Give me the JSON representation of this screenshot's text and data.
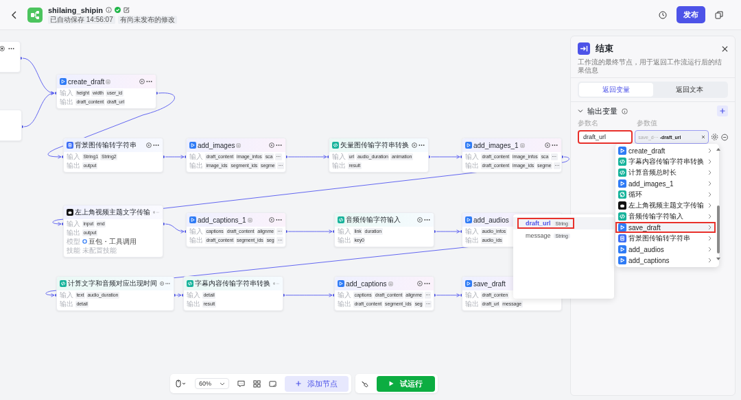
{
  "header": {
    "title": "shilaing_shipin",
    "badges": [
      "已自动保存 14:56:07",
      "有尚未发布的修改"
    ],
    "publish_button": "发布"
  },
  "canvas": {
    "nodes": [
      {
        "kind": "clipped",
        "actions": true
      },
      {
        "kind": "plugin",
        "title": "create_draft",
        "badge": true,
        "actions": true,
        "rows": [
          {
            "label": "输入",
            "kind": "params",
            "params": [
              "height",
              "width",
              "user_id"
            ]
          },
          {
            "label": "输出",
            "kind": "params",
            "params": [
              "draft_content",
              "draft_url"
            ]
          }
        ]
      },
      {
        "kind": "clipped",
        "actions": false
      },
      {
        "kind": "text",
        "title": "背景图传输转字符串",
        "badge": false,
        "actions": true,
        "rows": [
          {
            "label": "输入",
            "kind": "params",
            "params": [
              "String1",
              "String2"
            ]
          },
          {
            "label": "输出",
            "kind": "params",
            "params": [
              "output"
            ]
          }
        ]
      },
      {
        "kind": "plugin",
        "title": "add_images",
        "badge": true,
        "actions": true,
        "rows": [
          {
            "label": "输入",
            "kind": "params",
            "params": [
              "draft_content",
              "image_infos",
              "sca",
              "···"
            ]
          },
          {
            "label": "输出",
            "kind": "params",
            "params": [
              "image_ids",
              "segment_ids",
              "segme",
              "···"
            ]
          }
        ]
      },
      {
        "kind": "code",
        "title": "矢量图传输字符串转换",
        "badge": false,
        "actions": true,
        "rows": [
          {
            "label": "输入",
            "kind": "params",
            "params": [
              "url",
              "audio_duration",
              "animation"
            ]
          },
          {
            "label": "输出",
            "kind": "params",
            "params": [
              "result"
            ]
          }
        ]
      },
      {
        "kind": "plugin",
        "title": "add_images_1",
        "badge": true,
        "actions": true,
        "rows": [
          {
            "label": "输入",
            "kind": "params",
            "params": [
              "draft_content",
              "image_infos",
              "sca",
              "···"
            ]
          },
          {
            "label": "输出",
            "kind": "params",
            "params": [
              "draft_content",
              "image_ids",
              "segme",
              "···"
            ]
          }
        ]
      },
      {
        "kind": "bot",
        "title": "左上角视频主题文字传输",
        "badge": false,
        "actions": true,
        "rows": [
          {
            "label": "输入",
            "kind": "params",
            "params": [
              "input",
              "end"
            ]
          },
          {
            "label": "输出",
            "kind": "params",
            "params": [
              "output"
            ]
          },
          {
            "label": "模型",
            "kind": "model",
            "value": "豆包・工具调用"
          },
          {
            "label": "技能",
            "kind": "text",
            "value": "未配置技能"
          }
        ]
      },
      {
        "kind": "plugin",
        "title": "add_captions_1",
        "badge": true,
        "actions": true,
        "rows": [
          {
            "label": "输入",
            "kind": "params",
            "params": [
              "captions",
              "draft_content",
              "alignme",
              "···"
            ]
          },
          {
            "label": "输出",
            "kind": "params",
            "params": [
              "draft_content",
              "segment_ids",
              "seg",
              "···"
            ]
          }
        ]
      },
      {
        "kind": "code",
        "title": "音频传输字符输入",
        "badge": false,
        "actions": true,
        "rows": [
          {
            "label": "输入",
            "kind": "params",
            "params": [
              "link",
              "duration"
            ]
          },
          {
            "label": "输出",
            "kind": "params",
            "params": [
              "key0"
            ]
          }
        ]
      },
      {
        "kind": "plugin",
        "title": "add_audios",
        "badge": false,
        "rows": [
          {
            "label": "输入",
            "kind": "params",
            "params": [
              "audio_infos"
            ]
          },
          {
            "label": "输出",
            "kind": "params",
            "params": [
              "audio_ids"
            ]
          }
        ]
      },
      {
        "kind": "code",
        "title": "计算文字和音频对应出现时间",
        "badge": false,
        "actions": true,
        "rows": [
          {
            "label": "输入",
            "kind": "params",
            "params": [
              "text",
              "audio_duration"
            ]
          },
          {
            "label": "输出",
            "kind": "params",
            "params": [
              "detail"
            ]
          }
        ]
      },
      {
        "kind": "code",
        "title": "字幕内容传输字符串转换",
        "badge": false,
        "actions": true,
        "rows": [
          {
            "label": "输入",
            "kind": "params",
            "params": [
              "detail"
            ]
          },
          {
            "label": "输出",
            "kind": "params",
            "params": [
              "result"
            ]
          }
        ]
      },
      {
        "kind": "plugin",
        "title": "add_captions",
        "badge": true,
        "actions": true,
        "rows": [
          {
            "label": "输入",
            "kind": "params",
            "params": [
              "captions",
              "draft_content",
              "alignme",
              "···"
            ]
          },
          {
            "label": "输出",
            "kind": "params",
            "params": [
              "draft_content",
              "segment_ids",
              "seg",
              "···"
            ]
          }
        ]
      },
      {
        "kind": "plugin",
        "title": "save_draft",
        "badge": false,
        "rows": [
          {
            "label": "输入",
            "kind": "params",
            "params": [
              "draft_conten"
            ]
          },
          {
            "label": "输出",
            "kind": "params",
            "params": [
              "draft_url",
              "message"
            ]
          }
        ]
      }
    ],
    "variable_popup": {
      "items": [
        {
          "name": "draft_url",
          "type": "String",
          "selected": true,
          "annotated": true
        },
        {
          "name": "message",
          "type": "String",
          "selected": false,
          "annotated": false
        }
      ]
    }
  },
  "end_panel": {
    "title": "结束",
    "description": "工作流的最终节点，用于返回工作流运行后的结果信息",
    "tabs": [
      {
        "label": "返回变量",
        "selected": true
      },
      {
        "label": "返回文本",
        "selected": false
      }
    ],
    "section": {
      "title": "输出变量",
      "expanded": true,
      "columns": [
        "参数名",
        "参数值"
      ],
      "rows": [
        {
          "name": "draft_url",
          "name_annotated": true,
          "ref_node": "save_d···",
          "ref_var": "-draft_url"
        }
      ]
    },
    "node_dropdown": {
      "items": [
        {
          "kind": "plugin",
          "name": "create_draft",
          "selected": false,
          "annotated": false
        },
        {
          "kind": "code",
          "name": "字幕内容传输字符串转换",
          "selected": false,
          "annotated": false
        },
        {
          "kind": "code",
          "name": "计算音频总时长",
          "selected": false,
          "annotated": false
        },
        {
          "kind": "plugin",
          "name": "add_images_1",
          "selected": false,
          "annotated": false
        },
        {
          "kind": "loop",
          "name": "循环",
          "selected": false,
          "annotated": false
        },
        {
          "kind": "bot",
          "name": "左上角视频主题文字传输",
          "selected": false,
          "annotated": false
        },
        {
          "kind": "code",
          "name": "音频传输字符输入",
          "selected": false,
          "annotated": false
        },
        {
          "kind": "plugin",
          "name": "save_draft",
          "selected": true,
          "annotated": true
        },
        {
          "kind": "text",
          "name": "背景图传输转字符串",
          "selected": false,
          "annotated": false
        },
        {
          "kind": "plugin",
          "name": "add_audios",
          "selected": false,
          "annotated": false
        },
        {
          "kind": "plugin",
          "name": "add_captions",
          "selected": false,
          "annotated": false
        }
      ]
    }
  },
  "toolbar": {
    "zoom": "60%",
    "add_node": "添加节点",
    "test_run": "试运行"
  }
}
